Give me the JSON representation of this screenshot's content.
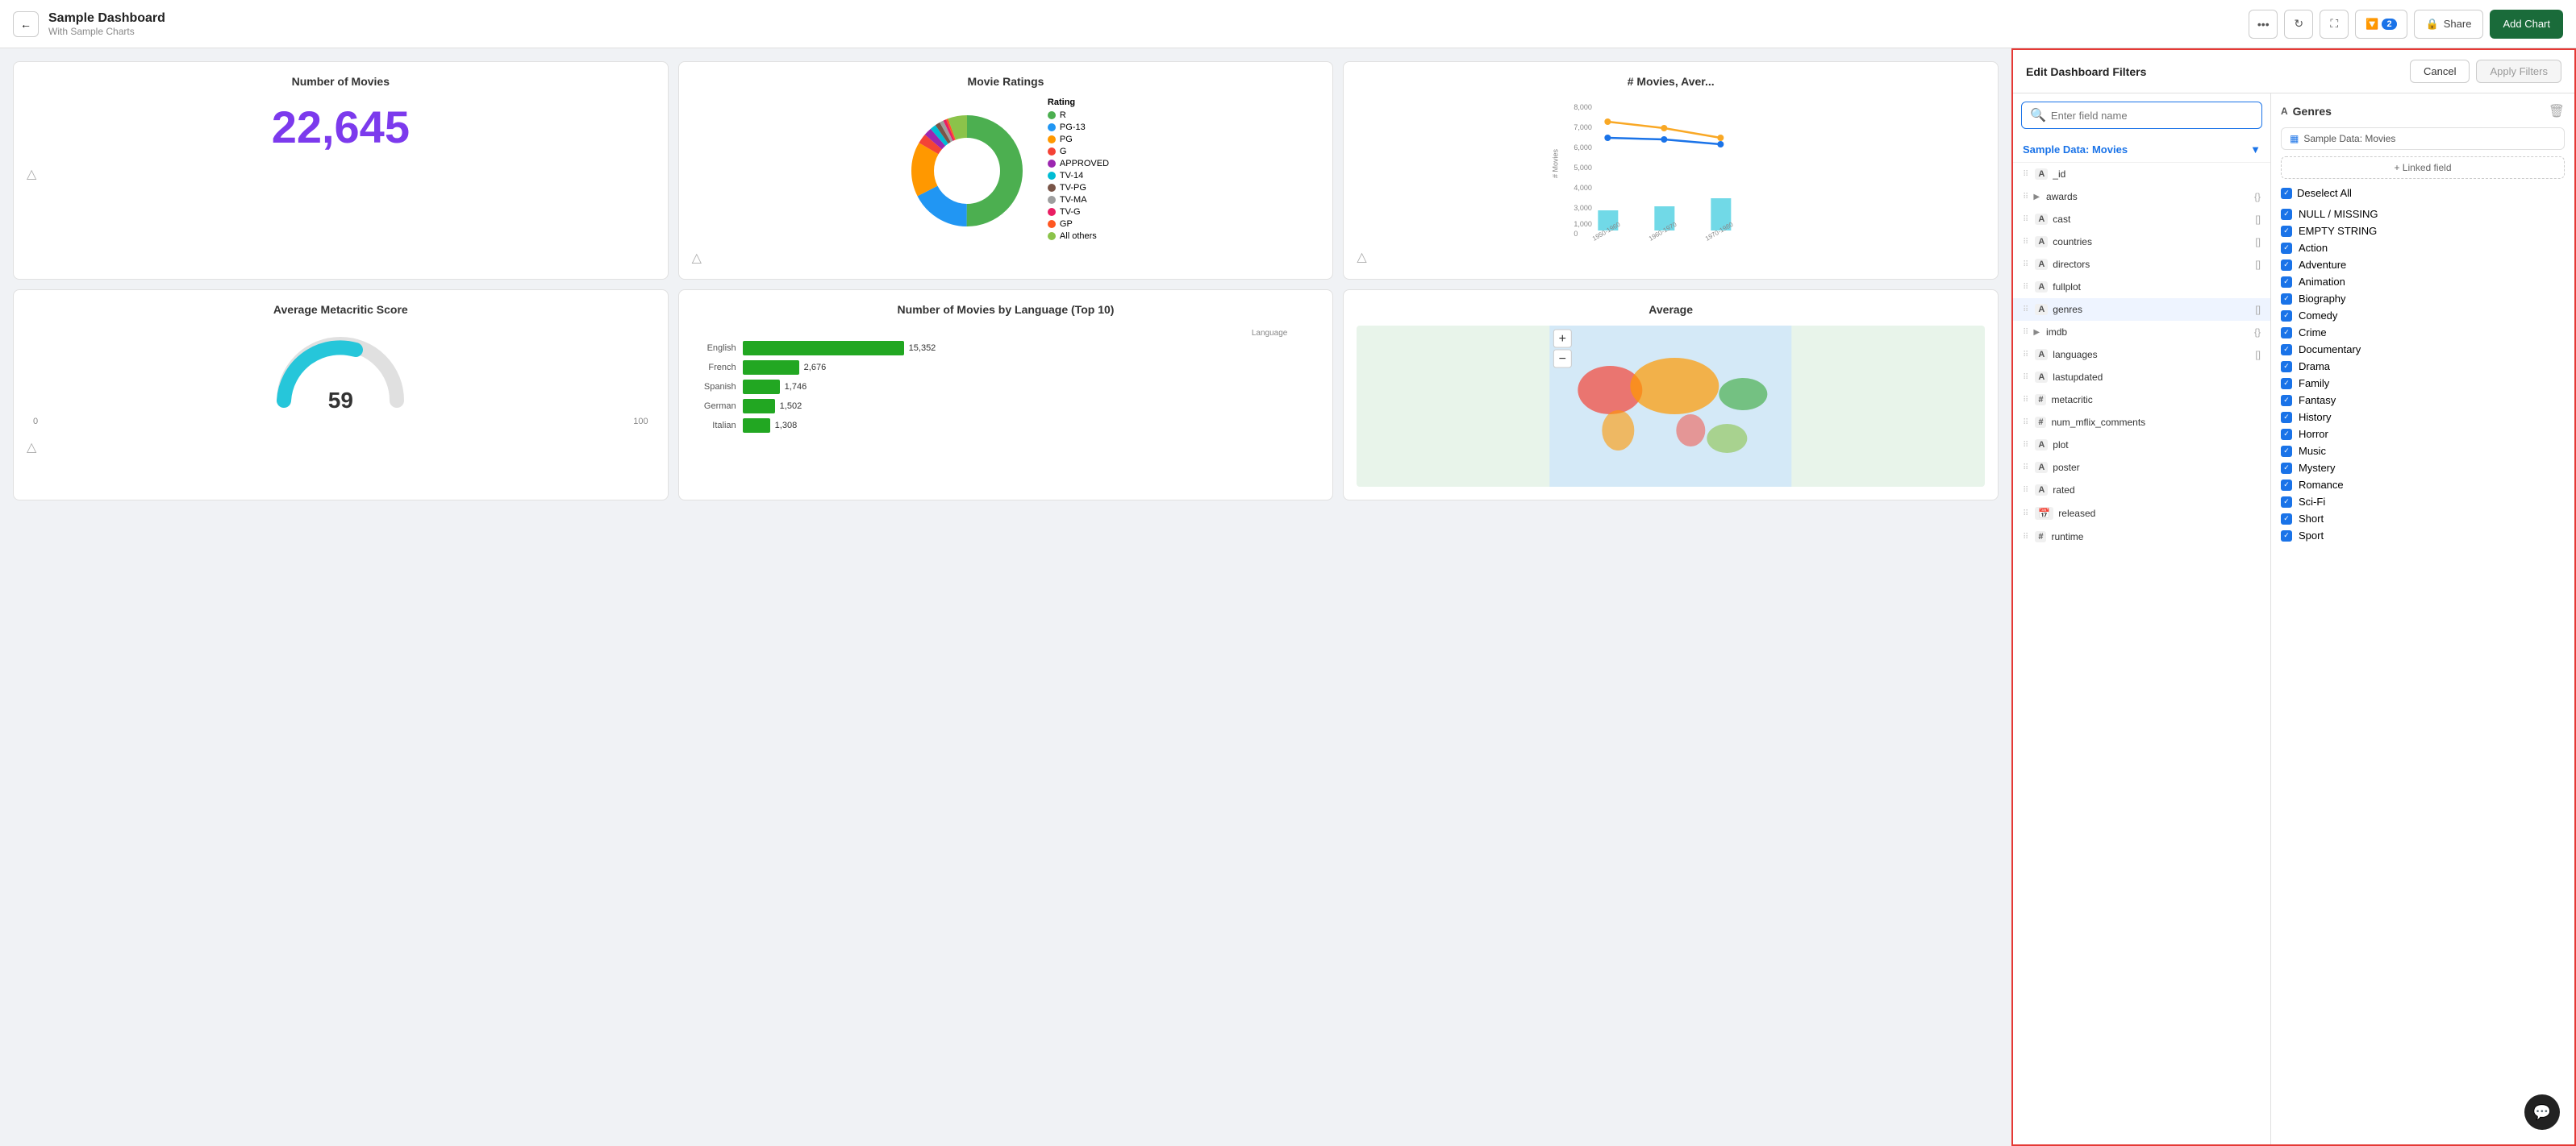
{
  "topbar": {
    "back_label": "←",
    "title": "Sample Dashboard",
    "subtitle": "With Sample Charts",
    "more_label": "•••",
    "refresh_label": "↻",
    "fullscreen_label": "⛶",
    "filter_label": "🔽",
    "filter_count": "2",
    "share_label": "🔒 Share",
    "add_chart_label": "Add Chart"
  },
  "panel": {
    "title": "Edit Dashboard Filters",
    "cancel_label": "Cancel",
    "apply_label": "Apply Filters",
    "search_placeholder": "Enter field name",
    "source_label": "Sample Data: Movies",
    "fields": [
      {
        "type": "_id",
        "name": "_id",
        "icon": "A",
        "right": ""
      },
      {
        "type": "group",
        "name": "awards",
        "icon": "▶",
        "right": "{}"
      },
      {
        "type": "text",
        "name": "cast",
        "icon": "A",
        "right": "[]"
      },
      {
        "type": "text",
        "name": "countries",
        "icon": "A",
        "right": "[]"
      },
      {
        "type": "text",
        "name": "directors",
        "icon": "A",
        "right": "[]"
      },
      {
        "type": "text",
        "name": "fullplot",
        "icon": "A",
        "right": ""
      },
      {
        "type": "text",
        "name": "genres",
        "icon": "A",
        "right": "[]"
      },
      {
        "type": "group",
        "name": "imdb",
        "icon": "▶",
        "right": "{}"
      },
      {
        "type": "text",
        "name": "languages",
        "icon": "A",
        "right": "[]"
      },
      {
        "type": "text",
        "name": "lastupdated",
        "icon": "A",
        "right": ""
      },
      {
        "type": "num",
        "name": "metacritic",
        "icon": "#",
        "right": ""
      },
      {
        "type": "num",
        "name": "num_mflix_comments",
        "icon": "#",
        "right": ""
      },
      {
        "type": "text",
        "name": "plot",
        "icon": "A",
        "right": ""
      },
      {
        "type": "text",
        "name": "poster",
        "icon": "A",
        "right": ""
      },
      {
        "type": "text",
        "name": "rated",
        "icon": "A",
        "right": ""
      },
      {
        "type": "date",
        "name": "released",
        "icon": "📅",
        "right": ""
      },
      {
        "type": "num",
        "name": "runtime",
        "icon": "#",
        "right": ""
      }
    ],
    "filter_title": "Genres",
    "filter_source": "Sample Data: Movies",
    "linked_field_label": "+ Linked field",
    "deselect_all_label": "Deselect All",
    "checkboxes": [
      {
        "label": "NULL / MISSING",
        "checked": true
      },
      {
        "label": "EMPTY STRING",
        "checked": true
      },
      {
        "label": "Action",
        "checked": true
      },
      {
        "label": "Adventure",
        "checked": true
      },
      {
        "label": "Animation",
        "checked": true
      },
      {
        "label": "Biography",
        "checked": true
      },
      {
        "label": "Comedy",
        "checked": true
      },
      {
        "label": "Crime",
        "checked": true
      },
      {
        "label": "Documentary",
        "checked": true
      },
      {
        "label": "Drama",
        "checked": true
      },
      {
        "label": "Family",
        "checked": true
      },
      {
        "label": "Fantasy",
        "checked": true
      },
      {
        "label": "History",
        "checked": true
      },
      {
        "label": "Horror",
        "checked": true
      },
      {
        "label": "Music",
        "checked": true
      },
      {
        "label": "Mystery",
        "checked": true
      },
      {
        "label": "Romance",
        "checked": true
      },
      {
        "label": "Sci-Fi",
        "checked": true
      },
      {
        "label": "Short",
        "checked": true
      },
      {
        "label": "Sport",
        "checked": true
      }
    ]
  },
  "charts": {
    "movies_count_title": "Number of Movies",
    "movies_count_value": "22,645",
    "movie_ratings_title": "Movie Ratings",
    "avg_meta_title": "Average Metacritic Score",
    "avg_meta_value": "59",
    "avg_meta_min": "0",
    "avg_meta_max": "100",
    "lang_chart_title": "Number of Movies by Language (Top 10)",
    "lang_data": [
      {
        "lang": "English",
        "value": 15352
      },
      {
        "lang": "French",
        "value": 2676
      },
      {
        "lang": "Spanish",
        "value": 1746
      },
      {
        "lang": "German",
        "value": 1502
      },
      {
        "lang": "Italian",
        "value": 1308
      }
    ],
    "line_chart_title": "# Movies, Aver...",
    "map_chart_title": "Average"
  },
  "legend": {
    "items": [
      {
        "label": "R",
        "color": "#4caf50"
      },
      {
        "label": "PG-13",
        "color": "#2196f3"
      },
      {
        "label": "PG",
        "color": "#ff9800"
      },
      {
        "label": "G",
        "color": "#f44336"
      },
      {
        "label": "APPROVED",
        "color": "#9c27b0"
      },
      {
        "label": "TV-14",
        "color": "#00bcd4"
      },
      {
        "label": "TV-PG",
        "color": "#795548"
      },
      {
        "label": "TV-MA",
        "color": "#9e9e9e"
      },
      {
        "label": "TV-G",
        "color": "#e91e63"
      },
      {
        "label": "GP",
        "color": "#ff5722"
      },
      {
        "label": "All others",
        "color": "#8bc34a"
      }
    ]
  }
}
